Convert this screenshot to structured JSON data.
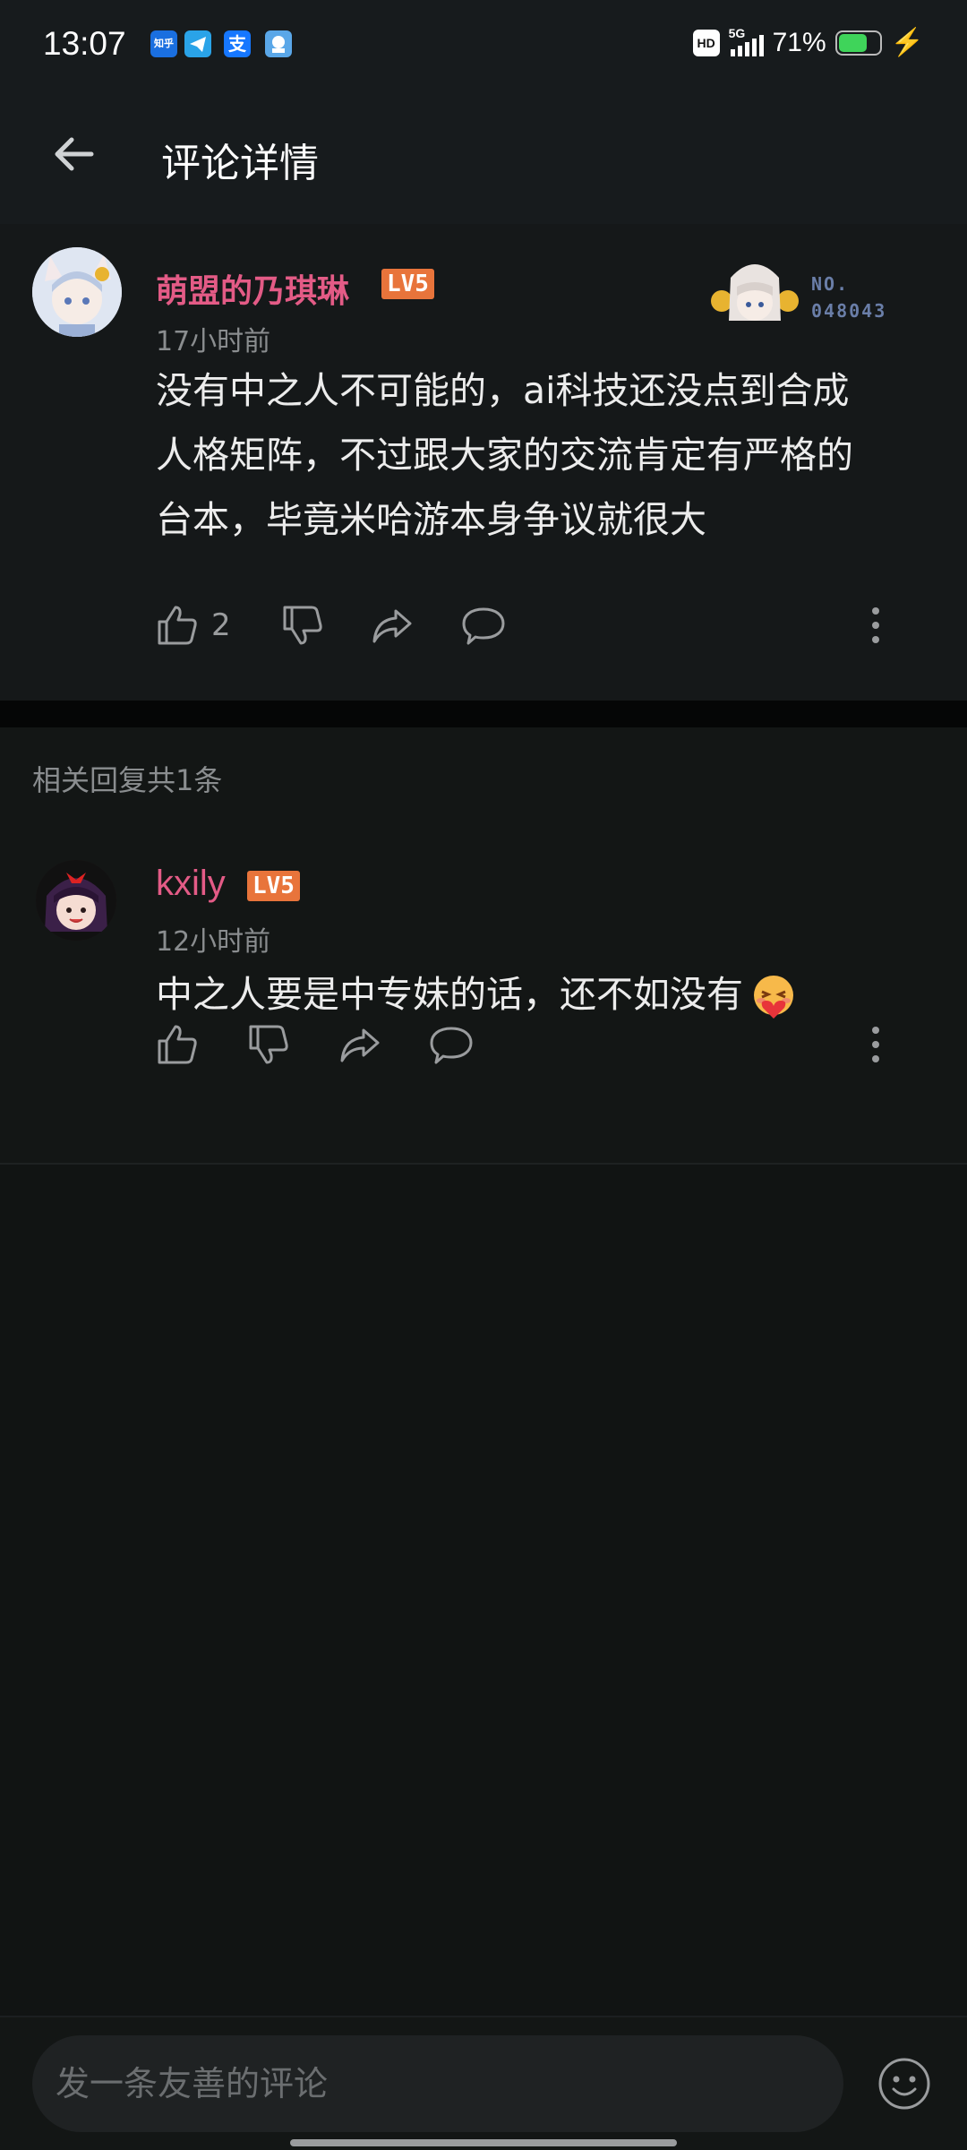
{
  "status_bar": {
    "time": "13:07",
    "notification_icons": [
      "zhihu-icon",
      "telegram-icon",
      "alipay-icon",
      "app-icon"
    ],
    "zhihu_label": "知乎",
    "alipay_label": "支",
    "hd_label": "HD",
    "network_label": "5G",
    "battery_percent": "71%",
    "battery_level": 0.71
  },
  "header": {
    "title": "评论详情"
  },
  "main_comment": {
    "username": "萌盟的乃琪琳",
    "level": "LV5",
    "time": "17小时前",
    "text_lines": [
      "没有中之人不可能的，ai科技还没点到合成",
      "人格矩阵，不过跟大家的交流肯定有严格的",
      "台本，毕竟米哈游本身争议就很大"
    ],
    "likes": "2",
    "fan_badge": {
      "no_label": "NO.",
      "number": "048043"
    }
  },
  "replies": {
    "header": "相关回复共1条",
    "items": [
      {
        "username": "kxily",
        "level": "LV5",
        "time": "12小时前",
        "text": "中之人要是中专妹的话，还不如没有"
      }
    ]
  },
  "bottom_bar": {
    "placeholder": "发一条友善的评论"
  },
  "colors": {
    "username": "#e35b86",
    "level_badge": "#e8743b",
    "background": "#111413",
    "battery": "#3fd45a"
  }
}
